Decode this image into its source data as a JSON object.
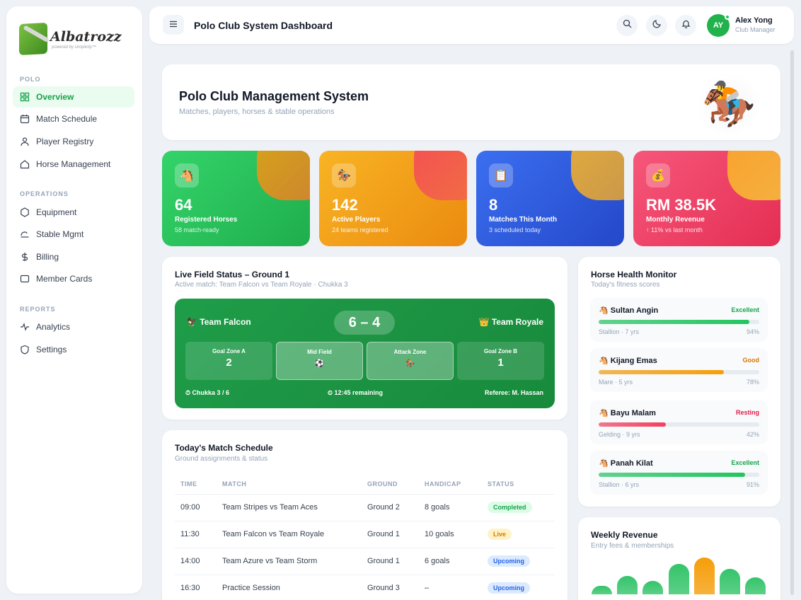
{
  "sidebar": {
    "logo_name": "Albatrozz",
    "logo_sub": "powered by simplicity™",
    "sections": [
      "POLO",
      "OPERATIONS",
      "REPORTS"
    ],
    "items": [
      {
        "label": "Overview",
        "icon": "grid-icon"
      },
      {
        "label": "Match Schedule",
        "icon": "calendar-icon"
      },
      {
        "label": "Player Registry",
        "icon": "user-icon"
      },
      {
        "label": "Horse Management",
        "icon": "home-icon"
      },
      {
        "label": "Equipment",
        "icon": "hexagon-icon"
      },
      {
        "label": "Stable Mgmt",
        "icon": "stable-icon"
      },
      {
        "label": "Billing",
        "icon": "dollar-icon"
      },
      {
        "label": "Member Cards",
        "icon": "card-icon"
      },
      {
        "label": "Analytics",
        "icon": "activity-icon"
      },
      {
        "label": "Settings",
        "icon": "shield-icon"
      }
    ]
  },
  "header": {
    "title": "Polo Club System Dashboard",
    "user_initials": "AY",
    "user_name": "Alex Yong",
    "user_role": "Club Manager"
  },
  "hero": {
    "title": "Polo Club Management System",
    "subtitle": "Matches, players, horses & stable operations",
    "emoji": "🏇"
  },
  "stats": [
    {
      "icon": "🐴",
      "value": "64",
      "label": "Registered Horses",
      "sub": "58 match-ready"
    },
    {
      "icon": "🏇",
      "value": "142",
      "label": "Active Players",
      "sub": "24 teams registered"
    },
    {
      "icon": "📋",
      "value": "8",
      "label": "Matches This Month",
      "sub": "3 scheduled today"
    },
    {
      "icon": "💰",
      "value": "RM 38.5K",
      "label": "Monthly Revenue",
      "sub": "↑ 11% vs last month"
    }
  ],
  "field": {
    "title": "Live Field Status – Ground 1",
    "subtitle": "Active match: Team Falcon vs Team Royale · Chukka 3",
    "team_a": "🦅 Team Falcon",
    "team_b": "👑 Team Royale",
    "score": "6 – 4",
    "zones": [
      {
        "name": "Goal Zone A",
        "value": "2"
      },
      {
        "name": "Mid Field",
        "value": "⚽"
      },
      {
        "name": "Attack Zone",
        "value": "🏇"
      },
      {
        "name": "Goal Zone B",
        "value": "1"
      }
    ],
    "chukka": "⏱ Chukka 3 / 6",
    "remaining": "⏲ 12:45 remaining",
    "referee": "Referee: M. Hassan"
  },
  "schedule": {
    "title": "Today's Match Schedule",
    "subtitle": "Ground assignments & status",
    "columns": [
      "TIME",
      "MATCH",
      "GROUND",
      "HANDICAP",
      "STATUS"
    ],
    "rows": [
      {
        "time": "09:00",
        "match": "Team Stripes vs Team Aces",
        "ground": "Ground 2",
        "handicap": "8 goals",
        "status": "Completed"
      },
      {
        "time": "11:30",
        "match": "Team Falcon vs Team Royale",
        "ground": "Ground 1",
        "handicap": "10 goals",
        "status": "Live"
      },
      {
        "time": "14:00",
        "match": "Team Azure vs Team Storm",
        "ground": "Ground 1",
        "handicap": "6 goals",
        "status": "Upcoming"
      },
      {
        "time": "16:30",
        "match": "Practice Session",
        "ground": "Ground 3",
        "handicap": "–",
        "status": "Upcoming"
      }
    ]
  },
  "horses": {
    "title": "Horse Health Monitor",
    "subtitle": "Today's fitness scores",
    "items": [
      {
        "name": "🐴 Sultan Angin",
        "status": "Excellent",
        "meta": "Stallion · 7 yrs",
        "pct": "94%",
        "value": 0.94,
        "color": "#22c55e",
        "status_color": "#16a34a"
      },
      {
        "name": "🐴 Kijang Emas",
        "status": "Good",
        "meta": "Mare · 5 yrs",
        "pct": "78%",
        "value": 0.78,
        "color": "#f59e0b",
        "status_color": "#d97706"
      },
      {
        "name": "🐴 Bayu Malam",
        "status": "Resting",
        "meta": "Gelding · 9 yrs",
        "pct": "42%",
        "value": 0.42,
        "color": "#f43f5e",
        "status_color": "#e11d48"
      },
      {
        "name": "🐴 Panah Kilat",
        "status": "Excellent",
        "meta": "Stallion · 6 yrs",
        "pct": "91%",
        "value": 0.91,
        "color": "#22c55e",
        "status_color": "#16a34a"
      }
    ]
  },
  "revenue": {
    "title": "Weekly Revenue",
    "subtitle": "Entry fees & memberships"
  },
  "chart_data": {
    "type": "bar",
    "title": "Weekly Revenue",
    "categories": [],
    "values": [
      0.18,
      0.38,
      0.28,
      0.62,
      0.75,
      0.52,
      0.34
    ],
    "highlight_index": 4,
    "colors": {
      "bar": "#34c46a",
      "highlight": "#f59e0b"
    }
  }
}
